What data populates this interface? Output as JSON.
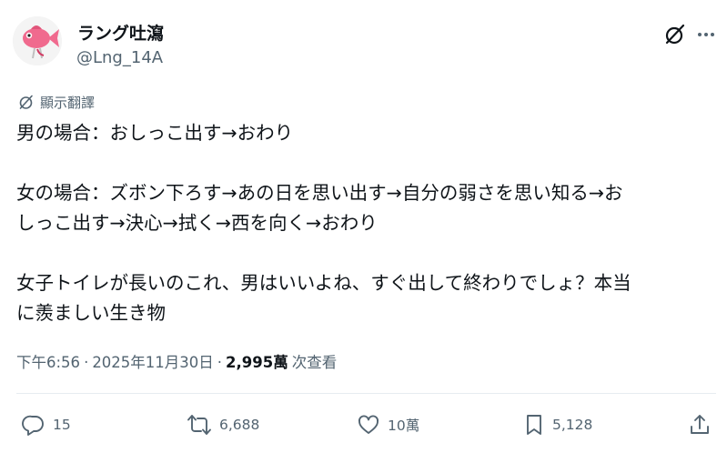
{
  "author": {
    "name": "ラング吐瀉",
    "handle": "@Lng_14A"
  },
  "icons": {
    "avatar": "pink-fish-avatar",
    "grok": "grok-icon",
    "more": "more-icon",
    "translate": "translate-icon",
    "reply": "reply-icon",
    "retweet": "retweet-icon",
    "like": "heart-icon",
    "bookmark": "bookmark-icon",
    "share": "share-icon"
  },
  "translate": {
    "label": "顯示翻譯"
  },
  "post": {
    "lines": [
      "男の場合：おしっこ出す→おわり",
      "",
      "女の場合：ズボン下ろす→あの日を思い出す→自分の弱さを思い知る→お",
      "しっこ出す→決心→拭く→西を向く→おわり",
      "",
      "女子トイレが長いのこれ、男はいいよね、すぐ出して終わりでしょ？本当",
      "に羨ましい生き物"
    ]
  },
  "meta": {
    "time": "下午6:56",
    "separator": "·",
    "date": "2025年11月30日",
    "views_count": "2,995萬",
    "views_label": "次查看"
  },
  "actions": {
    "replies": "15",
    "retweets": "6,688",
    "likes": "10萬",
    "bookmarks": "5,128"
  },
  "colors": {
    "text": "#0f1419",
    "secondary": "#536471",
    "divider": "#e6ecf0",
    "avatar_fish": "#f06a8e"
  }
}
